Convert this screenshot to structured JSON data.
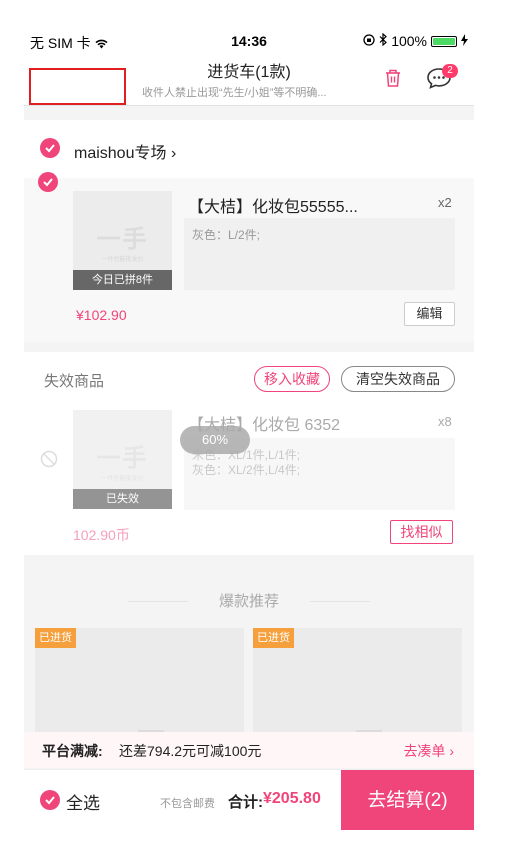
{
  "status_bar": {
    "carrier": "无 SIM 卡",
    "time": "14:36",
    "battery": "100%",
    "battery_level": 1.0
  },
  "nav": {
    "title": "进货车(1款)",
    "subtitle": "收件人禁止出现“先生/小姐”等不明确...",
    "message_badge": "2",
    "trash_icon": "trash-icon",
    "message_icon": "chat-bubble-icon"
  },
  "shop": {
    "name": "maishou专场",
    "chevron": "›",
    "item": {
      "thumb_logo": "一手",
      "thumb_tagline": "一件也能批发价",
      "thumb_tag": "今日已拼8件",
      "title": "【大桔】化妆包55555...",
      "qty": "x2",
      "spec": "灰色：L/2件;",
      "price": "¥102.90",
      "edit_label": "编辑"
    }
  },
  "invalid": {
    "label": "失效商品",
    "move_fav": "移入收藏",
    "clear": "清空失效商品",
    "item": {
      "thumb_logo": "一手",
      "thumb_tagline": "一件也能批发价",
      "thumb_tag": "已失效",
      "title": "【大桔】化妆包 6352",
      "qty": "x8",
      "percent": "60%",
      "spec_line1": "米色：XL/1件,L/1件;",
      "spec_line2": "灰色：XL/2件,L/4件;",
      "price": "102.90币",
      "similar_label": "找相似"
    }
  },
  "recommend": {
    "title": "爆款推荐",
    "cards": [
      {
        "tag": "已进货"
      },
      {
        "tag": "已进货"
      }
    ]
  },
  "promo": {
    "label": "平台满减:",
    "text": "还差794.2元可减100元",
    "link": "去凑单 ›"
  },
  "bottom_bar": {
    "select_all": "全选",
    "shipping_note": "不包含邮费",
    "total_label": "合计:",
    "total": "¥205.80",
    "checkout": "去结算(2)"
  },
  "colors": {
    "accent": "#f0457a",
    "tag_orange": "#f5a03c"
  }
}
